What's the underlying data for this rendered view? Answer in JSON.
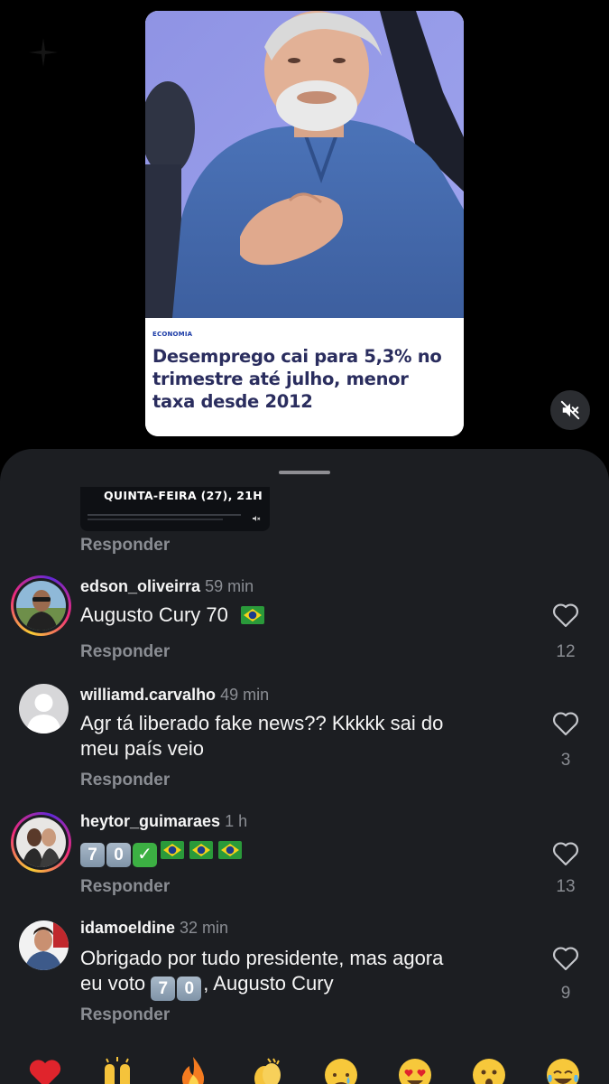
{
  "post": {
    "category": "ECONOMIA",
    "headline": "Desemprego cai para 5,3% no trimestre até julho, menor taxa desde 2012"
  },
  "media_controls": {
    "mute_icon": "speaker-muted-icon"
  },
  "previous_comment": {
    "thumbnail_title": "QUINTA-FEIRA (27), 21H",
    "reply_label": "Responder"
  },
  "comments": [
    {
      "username": "edson_oliveirra",
      "time": "59 min",
      "text": "Augusto Cury 70",
      "likes": "12",
      "reply_label": "Responder",
      "story_ring": true
    },
    {
      "username": "williamd.carvalho",
      "time": "49 min",
      "text_line1": "Agr tá liberado fake news?? Kkkkk sai do",
      "text_line2": "meu país veio",
      "likes": "3",
      "reply_label": "Responder",
      "story_ring": false
    },
    {
      "username": "heytor_guimaraes",
      "time": "1 h",
      "likes": "13",
      "reply_label": "Responder",
      "story_ring": true,
      "emoji_text": [
        "7",
        "0"
      ]
    },
    {
      "username": "idamoeldine",
      "time": "32 min",
      "text_line1": "Obrigado por tudo presidente, mas agora",
      "text_line2_prefix": "eu voto",
      "text_line2_suffix": ", Augusto Cury",
      "likes": "9",
      "reply_label": "Responder",
      "story_ring": false
    }
  ],
  "reaction_bar": [
    "red-heart-icon",
    "raising-hands-icon",
    "fire-icon",
    "clapping-hands-icon",
    "crying-face-icon",
    "heart-eyes-face-icon",
    "astonished-face-icon",
    "tears-of-joy-face-icon"
  ],
  "colors": {
    "sheet_bg": "#1c1e22",
    "muted_text": "#8a8d93",
    "headline": "#2a2d5e",
    "tag": "#1a3aa6"
  }
}
